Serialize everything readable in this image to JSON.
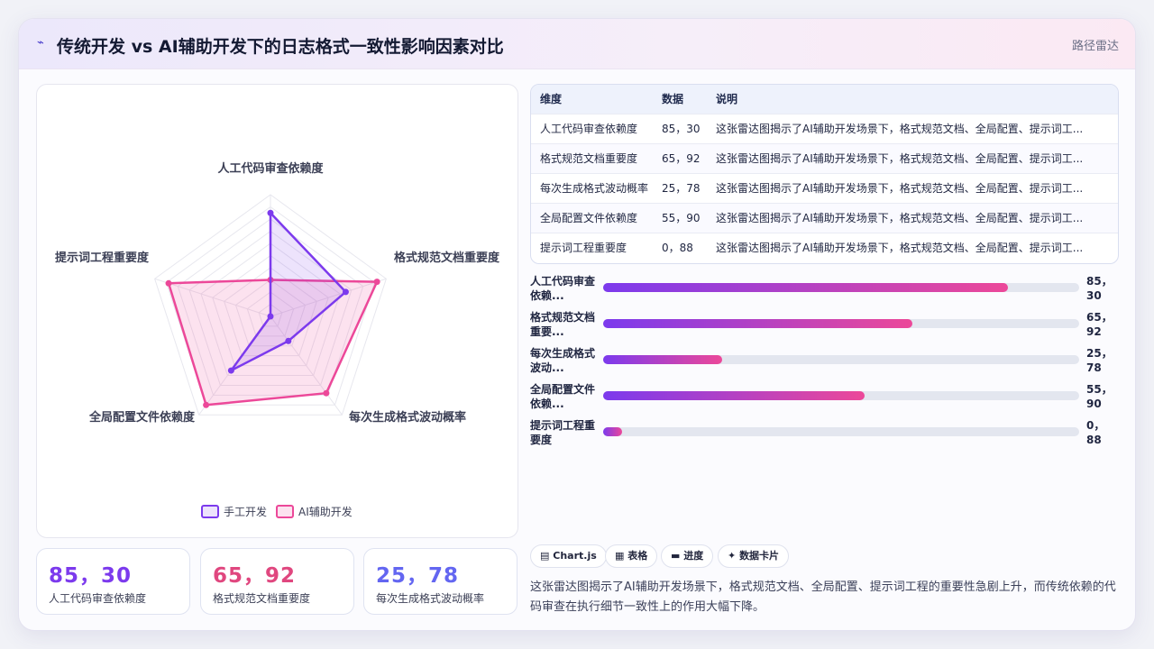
{
  "header": {
    "logo_icon": "pulse-icon",
    "logo_glyph": "⌁",
    "title": "传统开发 vs AI辅助开发下的日志格式一致性影响因素对比",
    "tag": "路径雷达"
  },
  "chart_data": {
    "type": "radar",
    "title": "",
    "categories": [
      "人工代码审查依赖度",
      "格式规范文档重要度",
      "每次生成格式波动概率",
      "全局配置文件依赖度",
      "提示词工程重要度"
    ],
    "series": [
      {
        "name": "手工开发",
        "values": [
          85,
          65,
          25,
          55,
          0
        ],
        "color": "#7c3aed"
      },
      {
        "name": "AI辅助开发",
        "values": [
          30,
          92,
          78,
          90,
          88
        ],
        "color": "#ec4899"
      }
    ],
    "range": [
      0,
      100
    ],
    "grid": true,
    "legend_position": "bottom"
  },
  "stats": [
    {
      "value": "85，30",
      "label": "人工代码审查依赖度",
      "color": "#7c3aed"
    },
    {
      "value": "65，92",
      "label": "格式规范文档重要度",
      "color": "#e0477f"
    },
    {
      "value": "25，78",
      "label": "每次生成格式波动概率",
      "color": "#6366f1"
    }
  ],
  "table": {
    "headers": [
      "维度",
      "数据",
      "说明"
    ],
    "rows": [
      {
        "dim": "人工代码审查依赖度",
        "data": "85，30",
        "note": "这张雷达图揭示了AI辅助开发场景下，格式规范文档、全局配置、提示词工..."
      },
      {
        "dim": "格式规范文档重要度",
        "data": "65，92",
        "note": "这张雷达图揭示了AI辅助开发场景下，格式规范文档、全局配置、提示词工..."
      },
      {
        "dim": "每次生成格式波动概率",
        "data": "25，78",
        "note": "这张雷达图揭示了AI辅助开发场景下，格式规范文档、全局配置、提示词工..."
      },
      {
        "dim": "全局配置文件依赖度",
        "data": "55，90",
        "note": "这张雷达图揭示了AI辅助开发场景下，格式规范文档、全局配置、提示词工..."
      },
      {
        "dim": "提示词工程重要度",
        "data": "0，88",
        "note": "这张雷达图揭示了AI辅助开发场景下，格式规范文档、全局配置、提示词工..."
      }
    ]
  },
  "bars": [
    {
      "label": "人工代码审查依赖...",
      "value_text": "85，30",
      "fraction": 0.85
    },
    {
      "label": "格式规范文档重要...",
      "value_text": "65，92",
      "fraction": 0.65
    },
    {
      "label": "每次生成格式波动...",
      "value_text": "25，78",
      "fraction": 0.25
    },
    {
      "label": "全局配置文件依赖...",
      "value_text": "55，90",
      "fraction": 0.55
    },
    {
      "label": "提示词工程重要度",
      "value_text": "0，88",
      "fraction": 0.04
    }
  ],
  "chips": [
    {
      "icon": "chart-icon",
      "glyph": "▤",
      "label": "Chart.js"
    },
    {
      "icon": "table-icon",
      "glyph": "▦",
      "label": "表格"
    },
    {
      "icon": "progress-icon",
      "glyph": "▬",
      "label": "进度"
    },
    {
      "icon": "sparkle-icon",
      "glyph": "✦",
      "label": "数据卡片"
    }
  ],
  "description": "这张雷达图揭示了AI辅助开发场景下，格式规范文档、全局配置、提示词工程的重要性急剧上升，而传统依赖的代码审查在执行细节一致性上的作用大幅下降。"
}
